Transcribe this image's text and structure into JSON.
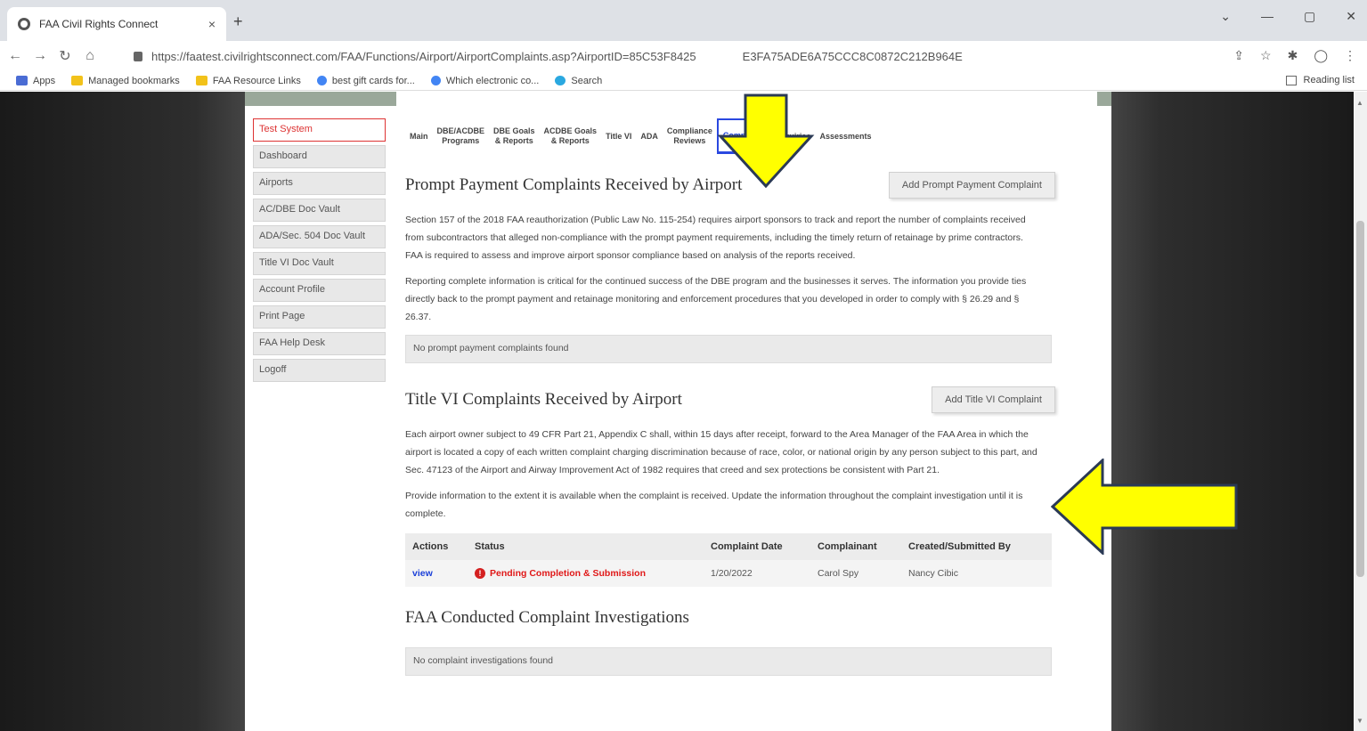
{
  "browser": {
    "tab_title": "FAA Civil Rights Connect",
    "tab_close": "×",
    "new_tab": "+",
    "url": "https://faatest.civilrightsconnect.com/FAA/Functions/Airport/AirportComplaints.asp?AirportID=85C53F8425",
    "url_tail": "E3FA75ADE6A75CCC8C0872C212B964E",
    "bookmarks": [
      "Apps",
      "Managed bookmarks",
      "FAA Resource Links",
      "best gift cards for...",
      "Which electronic co...",
      "Search"
    ],
    "reading_list": "Reading list"
  },
  "sidebar": {
    "items": [
      {
        "label": "Test System"
      },
      {
        "label": "Dashboard"
      },
      {
        "label": "Airports"
      },
      {
        "label": "AC/DBE Doc Vault"
      },
      {
        "label": "ADA/Sec. 504 Doc Vault"
      },
      {
        "label": "Title VI Doc Vault"
      },
      {
        "label": "Account Profile"
      },
      {
        "label": "Print Page"
      },
      {
        "label": "FAA Help Desk"
      },
      {
        "label": "Logoff"
      }
    ]
  },
  "tabs": [
    {
      "label": "Main"
    },
    {
      "label": "DBE/ACDBE\nPrograms"
    },
    {
      "label": "DBE Goals\n& Reports"
    },
    {
      "label": "ACDBE Goals\n& Reports"
    },
    {
      "label": "Title VI"
    },
    {
      "label": "ADA"
    },
    {
      "label": "Compliance\nReviews"
    },
    {
      "label": "Complaints"
    },
    {
      "label": "Inquiries"
    },
    {
      "label": "Assessments"
    }
  ],
  "prompt_payment": {
    "title": "Prompt Payment Complaints Received by Airport",
    "add_button": "Add Prompt Payment Complaint",
    "para1": "Section 157 of the 2018 FAA reauthorization (Public Law No. 115-254) requires airport sponsors to track and report the number of complaints received from subcontractors that alleged non-compliance with the prompt payment requirements, including the timely return of retainage by prime contractors. FAA is required to assess and improve airport sponsor compliance based on analysis of the reports received.",
    "para2": "Reporting complete information is critical for the continued success of the DBE program and the businesses it serves. The information you provide ties directly back to the prompt payment and retainage monitoring and enforcement procedures that you developed in order to comply with § 26.29 and § 26.37.",
    "empty": "No prompt payment complaints found"
  },
  "title_vi": {
    "title": "Title VI Complaints Received by Airport",
    "add_button": "Add Title VI Complaint",
    "para1": "Each airport owner subject to 49 CFR Part 21, Appendix C shall, within 15 days after receipt, forward to the Area Manager of the FAA Area in which the airport is located a copy of each written complaint charging discrimination because of race, color, or national origin by any person subject to this part, and Sec. 47123 of the Airport and Airway Improvement Act of 1982 requires that creed and sex protections be consistent with Part 21.",
    "para2": "Provide information to the extent it is available when the complaint is received. Update the information throughout the complaint investigation until it is complete.",
    "columns": {
      "actions": "Actions",
      "status": "Status",
      "date": "Complaint Date",
      "complainant": "Complainant",
      "created": "Created/Submitted By"
    },
    "rows": [
      {
        "action": "view",
        "status": "Pending Completion & Submission",
        "date": "1/20/2022",
        "complainant": "Carol Spy",
        "created": "Nancy Cibic"
      }
    ]
  },
  "investigations": {
    "title": "FAA Conducted Complaint Investigations",
    "empty": "No complaint investigations found"
  },
  "colors": {
    "accent": "#2a48e0",
    "alert": "#e01818",
    "annotation": "#ffff00"
  }
}
